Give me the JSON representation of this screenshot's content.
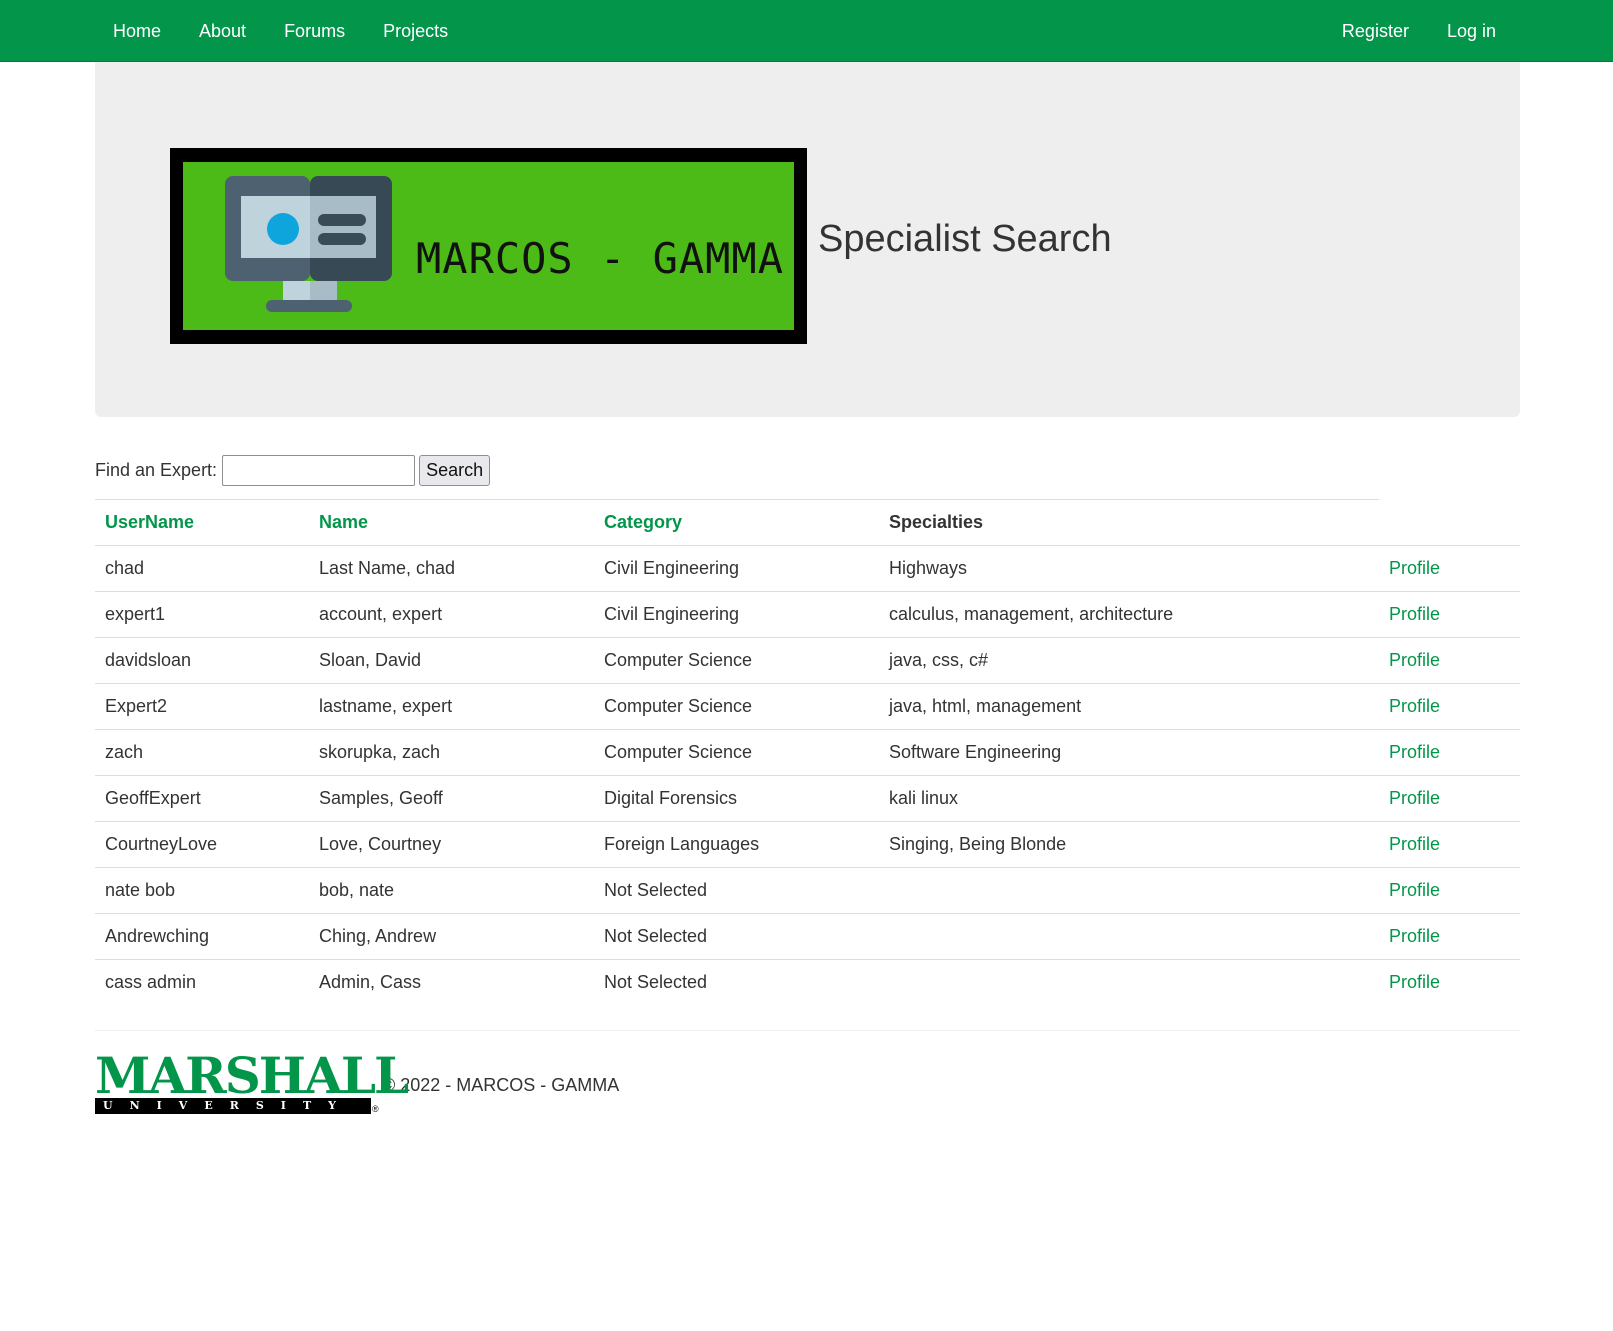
{
  "nav": {
    "left": [
      "Home",
      "About",
      "Forums",
      "Projects"
    ],
    "right": [
      "Register",
      "Log in"
    ]
  },
  "banner": {
    "text": "MARCOS - GAMMA",
    "background_color": "#4cbb17",
    "icon": "monitor-icon"
  },
  "page_title": "Specialist Search",
  "search": {
    "label": "Find an Expert:",
    "value": "",
    "button": "Search"
  },
  "table": {
    "headers": [
      "UserName",
      "Name",
      "Category",
      "Specialties",
      ""
    ],
    "rows": [
      {
        "username": "chad",
        "name": "Last Name, chad",
        "category": "Civil Engineering",
        "specialties": "Highways",
        "link": "Profile"
      },
      {
        "username": "expert1",
        "name": "account, expert",
        "category": "Civil Engineering",
        "specialties": "calculus, management, architecture",
        "link": "Profile"
      },
      {
        "username": "davidsloan",
        "name": "Sloan, David",
        "category": "Computer Science",
        "specialties": "java, css, c#",
        "link": "Profile"
      },
      {
        "username": "Expert2",
        "name": "lastname, expert",
        "category": "Computer Science",
        "specialties": "java, html, management",
        "link": "Profile"
      },
      {
        "username": "zach",
        "name": "skorupka, zach",
        "category": "Computer Science",
        "specialties": "Software Engineering",
        "link": "Profile"
      },
      {
        "username": "GeoffExpert",
        "name": "Samples, Geoff",
        "category": "Digital Forensics",
        "specialties": "kali linux",
        "link": "Profile"
      },
      {
        "username": "CourtneyLove",
        "name": "Love, Courtney",
        "category": "Foreign Languages",
        "specialties": "Singing, Being Blonde",
        "link": "Profile"
      },
      {
        "username": "nate bob",
        "name": "bob, nate",
        "category": "Not Selected",
        "specialties": "",
        "link": "Profile"
      },
      {
        "username": "Andrewching",
        "name": "Ching, Andrew",
        "category": "Not Selected",
        "specialties": "",
        "link": "Profile"
      },
      {
        "username": "cass admin",
        "name": "Admin, Cass",
        "category": "Not Selected",
        "specialties": "",
        "link": "Profile"
      }
    ]
  },
  "footer": {
    "logo_word": "MARSHALL",
    "logo_sub": "UNIVERSITY",
    "logo_reg": "®",
    "copyright": "© 2022 - MARCOS - GAMMA"
  },
  "colors": {
    "brand_green": "#03964b",
    "banner_green": "#4cbb17",
    "jumbotron": "#eeeeee"
  }
}
